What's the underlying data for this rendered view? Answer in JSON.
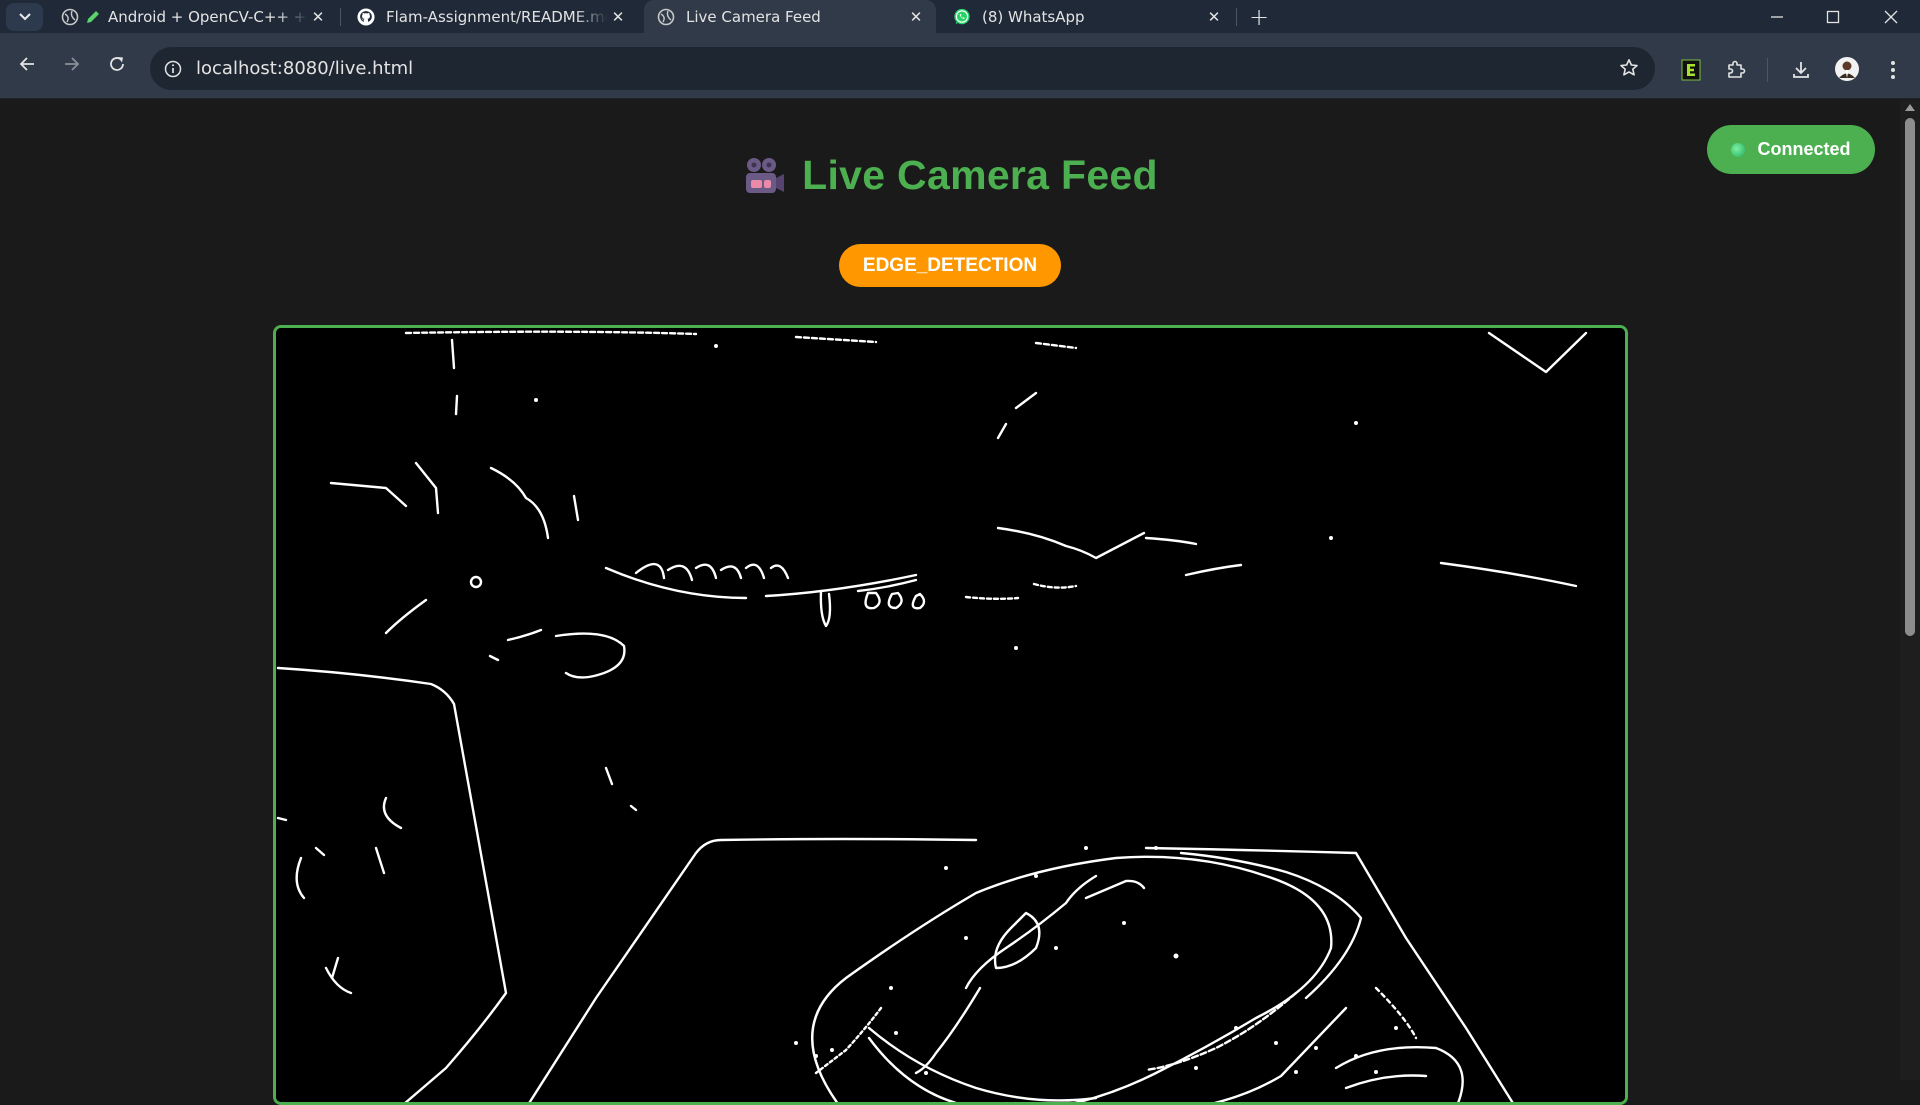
{
  "browser": {
    "tabs": [
      {
        "title": "Android + OpenCV-C++ + ",
        "favicon": "pencil-icon"
      },
      {
        "title": "Flam-Assignment/README.md",
        "favicon": "github-icon"
      },
      {
        "title": "Live Camera Feed",
        "favicon": "globe-icon",
        "active": true
      },
      {
        "title": "(8) WhatsApp",
        "favicon": "whatsapp-icon"
      }
    ],
    "url": "localhost:8080/live.html"
  },
  "page": {
    "status": "Connected",
    "title": "Live Camera Feed",
    "mode": "EDGE_DETECTION",
    "feed_image": "Edge-detected camera frame of a computer mouse on a mouse pad"
  },
  "colors": {
    "accent_green": "#4caf50",
    "mode_orange": "#ff9800",
    "background": "#1a1a1a"
  }
}
